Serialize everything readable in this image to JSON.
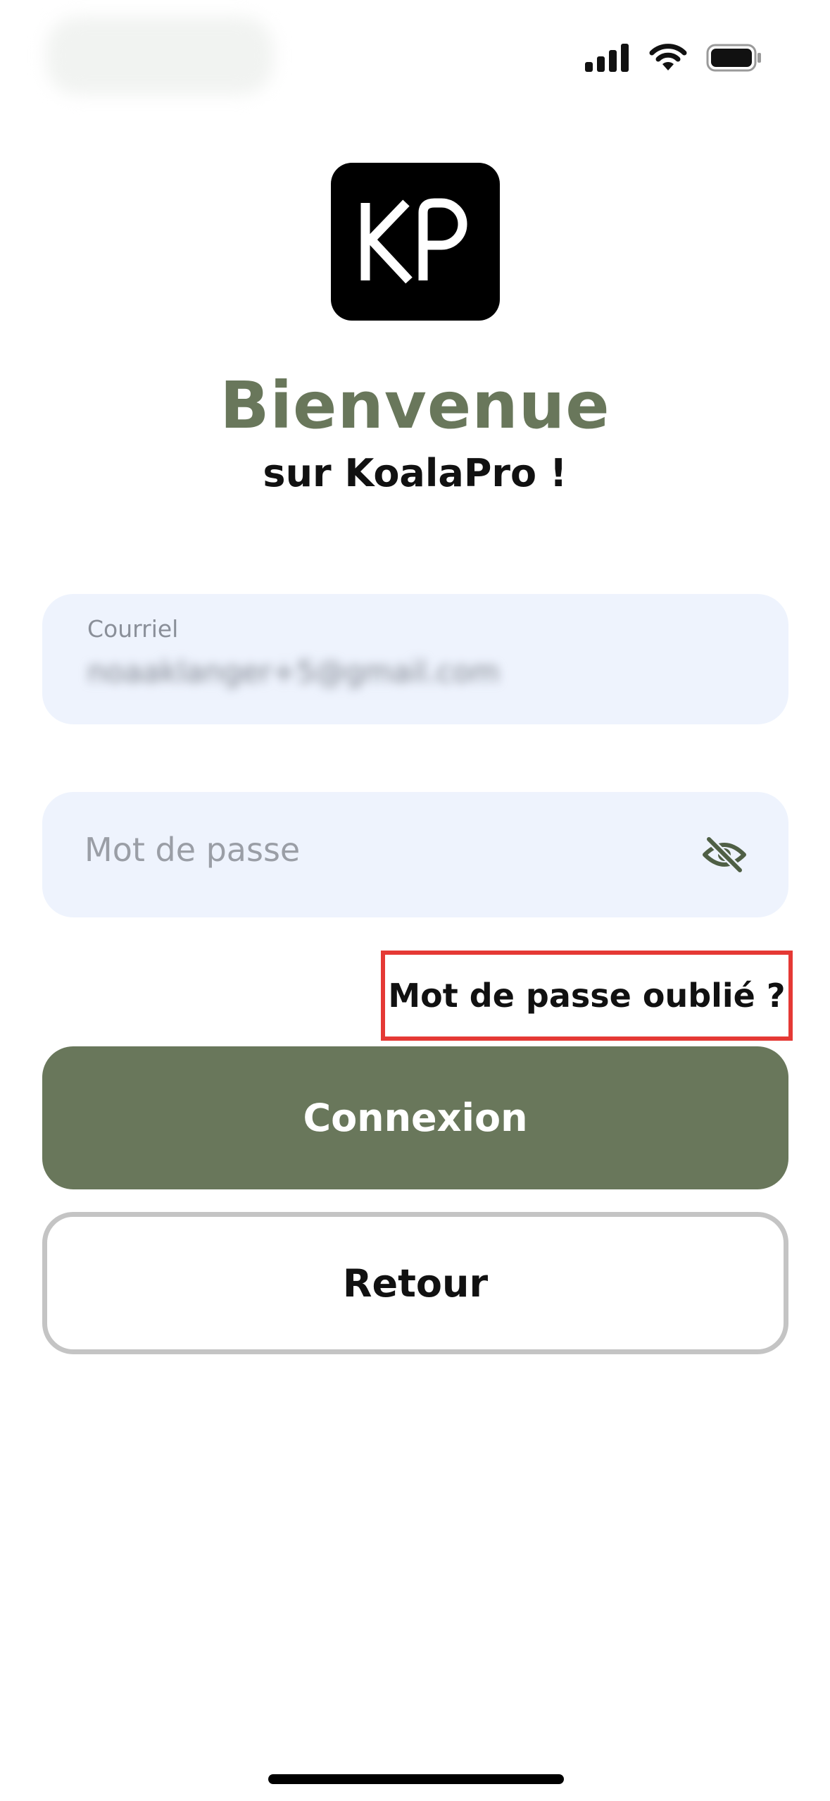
{
  "status_bar": {
    "time_blurred": true,
    "icons": [
      "signal-icon",
      "wifi-icon",
      "battery-icon"
    ]
  },
  "logo": {
    "text": "KP"
  },
  "header": {
    "title": "Bienvenue",
    "subtitle": "sur KoalaPro !"
  },
  "form": {
    "email": {
      "label": "Courriel",
      "value": "noaaklanger+5@gmail.com",
      "value_obscured": true
    },
    "password": {
      "placeholder": "Mot de passe",
      "visibility_icon": "eye-off-icon"
    },
    "forgot_password_label": "Mot de passe oublié ?"
  },
  "actions": {
    "login_label": "Connexion",
    "back_label": "Retour"
  },
  "colors": {
    "brand": "#69775b",
    "field_background": "#eef3fd",
    "highlight": "#e53935",
    "secondary_border": "#c4c4c4"
  }
}
